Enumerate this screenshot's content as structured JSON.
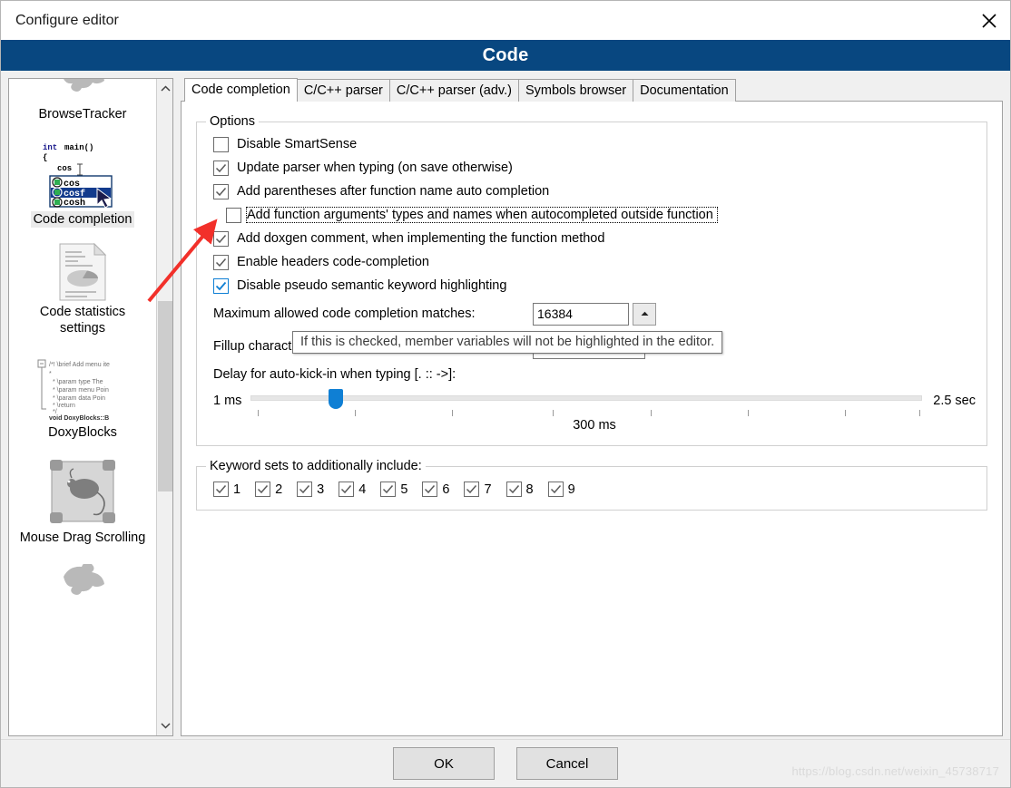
{
  "window": {
    "title": "Configure editor",
    "close_icon": "close-icon",
    "banner_title": "Code"
  },
  "sidebar": {
    "scroll_up_icon": "chevron-up-icon",
    "scroll_down_icon": "chevron-down-icon",
    "items": [
      {
        "label": "BrowseTracker",
        "icon": "puzzle-piece-icon",
        "selected": false
      },
      {
        "label": "Code completion",
        "icon": "code-completion-icon",
        "selected": true
      },
      {
        "label": "Code statistics settings",
        "icon": "document-chart-icon",
        "selected": false
      },
      {
        "label": "DoxyBlocks",
        "icon": "doxygen-comment-icon",
        "selected": false
      },
      {
        "label": "Mouse Drag Scrolling",
        "icon": "mouse-scroll-icon",
        "selected": false
      },
      {
        "label": "",
        "icon": "puzzle-piece-icon",
        "selected": false
      }
    ],
    "code_gfx": {
      "line1": "int main()",
      "line2": "{",
      "line3": "cos",
      "item1": "cos",
      "item2": "cosf",
      "item3": "cosh"
    }
  },
  "tabs": [
    {
      "label": "Code completion",
      "active": true
    },
    {
      "label": "C/C++ parser",
      "active": false
    },
    {
      "label": "C/C++ parser (adv.)",
      "active": false
    },
    {
      "label": "Symbols browser",
      "active": false
    },
    {
      "label": "Documentation",
      "active": false
    }
  ],
  "options_group": {
    "legend": "Options",
    "checkboxes": [
      {
        "label": "Disable SmartSense",
        "checked": false,
        "style": "normal",
        "focused": false
      },
      {
        "label": "Update parser when typing (on save otherwise)",
        "checked": true,
        "style": "normal",
        "focused": false
      },
      {
        "label": "Add parentheses after function name auto completion",
        "checked": true,
        "style": "normal",
        "focused": false
      },
      {
        "label": "Add function arguments' types and names when autocompleted outside function",
        "checked": false,
        "style": "normal",
        "focused": true
      },
      {
        "label": "Add doxgen comment, when implementing the function method",
        "checked": true,
        "style": "normal",
        "focused": false
      },
      {
        "label": "Enable headers code-completion",
        "checked": true,
        "style": "normal",
        "focused": false
      },
      {
        "label": "Disable pseudo semantic keyword highlighting",
        "checked": true,
        "style": "blue",
        "focused": false
      }
    ],
    "max_matches_label": "Maximum allowed code completion matches:",
    "max_matches_value": "16384",
    "spin_up_icon": "spinner-up-icon",
    "fillup_label": "Fillup characters:",
    "fillup_value": "",
    "delay_label": "Delay for auto-kick-in when typing [. :: ->]:",
    "delay_min": "1 ms",
    "delay_max": "2.5 sec",
    "delay_value": "300 ms",
    "delay_percent": 12.7
  },
  "keyword_group": {
    "legend": "Keyword sets to additionally include:",
    "sets": [
      {
        "label": "1",
        "checked": true
      },
      {
        "label": "2",
        "checked": true
      },
      {
        "label": "3",
        "checked": true
      },
      {
        "label": "4",
        "checked": true
      },
      {
        "label": "5",
        "checked": true
      },
      {
        "label": "6",
        "checked": true
      },
      {
        "label": "7",
        "checked": true
      },
      {
        "label": "8",
        "checked": true
      },
      {
        "label": "9",
        "checked": true
      }
    ]
  },
  "tooltip": {
    "text": "If this is checked, member variables will not be highlighted in the editor."
  },
  "footer": {
    "ok_label": "OK",
    "cancel_label": "Cancel",
    "watermark": "https://blog.csdn.net/weixin_45738717"
  },
  "annotation": {
    "arrow_color": "#f2302a",
    "arrow_name": "red-pointer-arrow"
  },
  "colors": {
    "banner_blue": "#084780",
    "accent_blue": "#0f7fd4",
    "selection_gray": "#eaeaea"
  }
}
